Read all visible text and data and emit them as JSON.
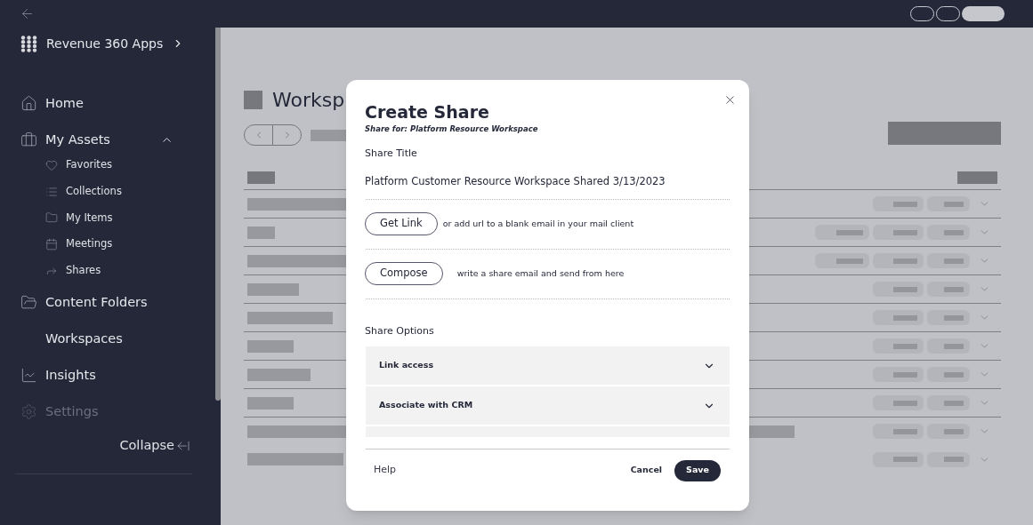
{
  "sidebar": {
    "app_switcher": "Revenue 360 Apps",
    "items": [
      {
        "label": "Home",
        "disabled": false
      },
      {
        "label": "My Assets",
        "disabled": false,
        "expanded": true,
        "children": [
          {
            "label": "Favorites"
          },
          {
            "label": "Collections"
          },
          {
            "label": "My Items"
          },
          {
            "label": "Meetings"
          },
          {
            "label": "Shares"
          }
        ]
      },
      {
        "label": "Content Folders",
        "disabled": false
      },
      {
        "label": "Workspaces",
        "disabled": false
      },
      {
        "label": "Insights",
        "disabled": false
      },
      {
        "label": "Settings",
        "disabled": true
      }
    ],
    "collapse": "Collapse"
  },
  "main": {
    "page_title": "Worksp"
  },
  "dialog": {
    "title": "Create Share",
    "subtitle": "Share for: Platform Resource Workspace",
    "share_title_label": "Share Title",
    "share_title_value": "Platform Customer Resource Workspace Shared 3/13/2023",
    "actions": [
      {
        "button": "Get Link",
        "description": "or add url to a blank email in your mail client"
      },
      {
        "button": "Compose",
        "description": "write a share email and send from here"
      }
    ],
    "options_heading": "Share Options",
    "options": [
      {
        "label": "Link access",
        "expanded": false
      },
      {
        "label": "Associate with CRM",
        "expanded": false
      }
    ],
    "help": "Help",
    "cancel": "Cancel",
    "save": "Save"
  }
}
